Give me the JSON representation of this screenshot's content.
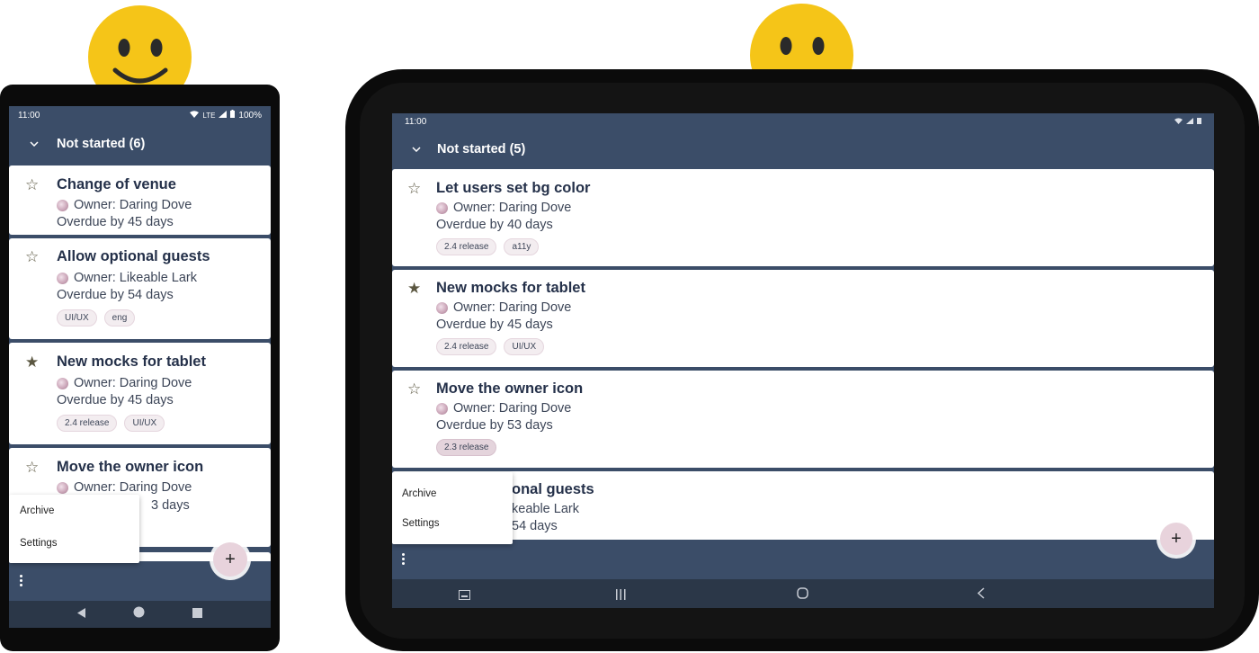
{
  "faces": {
    "left": "happy-face",
    "right": "sad-face",
    "color": "#f5c518"
  },
  "colors": {
    "appbar": "#3b4d68",
    "card": "#ffffff",
    "title": "#25314a",
    "star": "#5b5741"
  },
  "phone": {
    "status": {
      "time": "11:00",
      "network": "LTE",
      "battery": "100%"
    },
    "header_title": "Not started (6)",
    "cards": [
      {
        "starred": false,
        "title": "Change of venue",
        "owner": "Owner: Daring Dove",
        "due": "Overdue by 45 days",
        "chips": []
      },
      {
        "starred": false,
        "title": "Allow optional guests",
        "owner": "Owner: Likeable Lark",
        "due": "Overdue by 54 days",
        "chips": [
          "UI/UX",
          "eng"
        ]
      },
      {
        "starred": true,
        "title": "New mocks for tablet",
        "owner": "Owner: Daring Dove",
        "due": "Overdue by 45 days",
        "chips": [
          "2.4 release",
          "UI/UX"
        ]
      },
      {
        "starred": false,
        "title": "Move the owner icon",
        "owner": "Owner: Daring Dove",
        "due": "3 days",
        "chips": []
      }
    ],
    "menu": [
      "Archive",
      "Settings"
    ],
    "fab": "+",
    "nav": [
      "back-icon",
      "home-icon",
      "recents-icon"
    ]
  },
  "tablet": {
    "status": {
      "time": "11:00"
    },
    "header_title": "Not started (5)",
    "cards": [
      {
        "starred": false,
        "title": "Let users set bg color",
        "owner": "Owner: Daring Dove",
        "due": "Overdue by 40 days",
        "chips": [
          "2.4 release",
          "a11y"
        ]
      },
      {
        "starred": true,
        "title": "New mocks for tablet",
        "owner": "Owner: Daring Dove",
        "due": "Overdue by 45 days",
        "chips": [
          "2.4 release",
          "UI/UX"
        ]
      },
      {
        "starred": false,
        "title": "Move the owner icon",
        "owner": "Owner: Daring Dove",
        "due": "Overdue by 53 days",
        "chips": [
          "2.3 release"
        ]
      },
      {
        "starred": false,
        "title": "onal guests",
        "owner": "keable Lark",
        "due": "54 days",
        "chips": []
      }
    ],
    "menu": [
      "Archive",
      "Settings"
    ],
    "fab": "+",
    "nav": [
      "screenshot-icon",
      "recents-icon",
      "home-icon",
      "back-icon"
    ]
  }
}
